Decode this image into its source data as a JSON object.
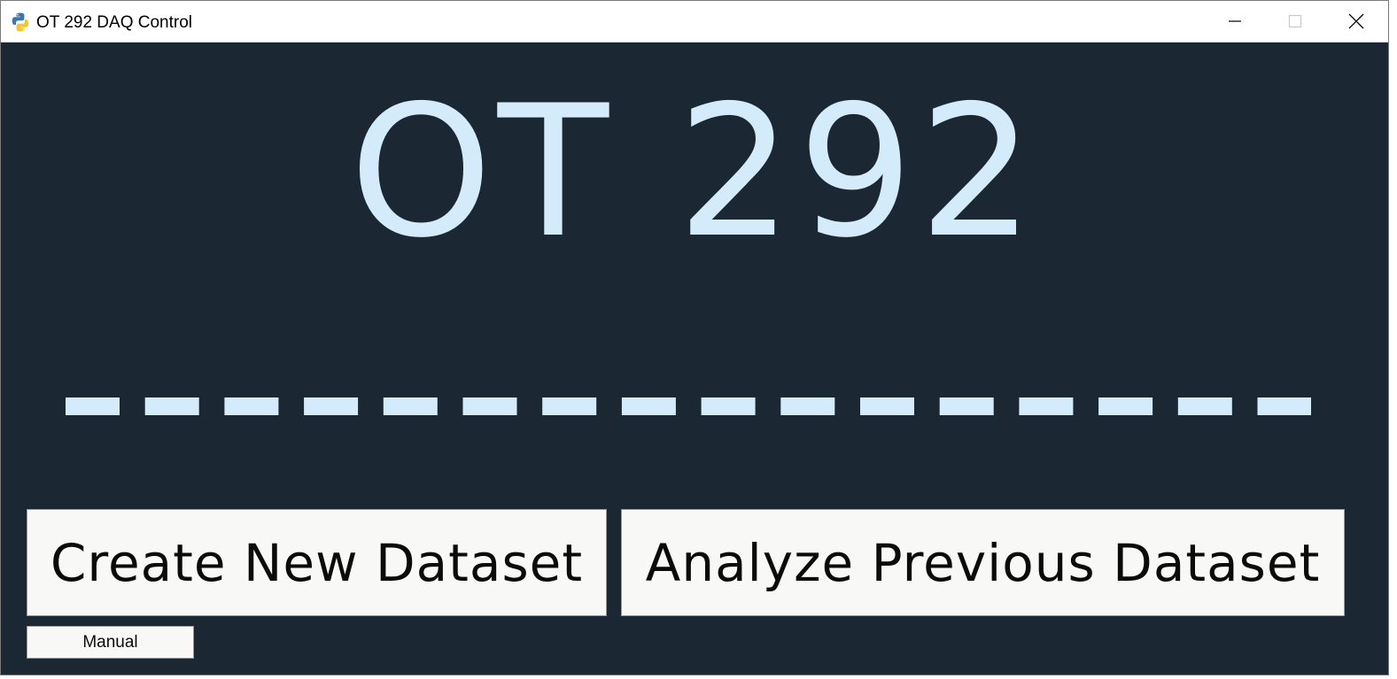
{
  "window": {
    "title": "OT 292 DAQ Control",
    "icon": "python-icon"
  },
  "controls": {
    "minimize": "minimize-icon",
    "maximize": "maximize-icon",
    "close": "close-icon"
  },
  "main": {
    "heading": "OT 292",
    "dash_count": 16,
    "buttons": {
      "create_label": "Create New Dataset",
      "analyze_label": "Analyze Previous Dataset",
      "manual_label": "Manual"
    }
  },
  "colors": {
    "background": "#1c2734",
    "accent": "#d4ebfb",
    "button_bg": "#f8f8f6"
  }
}
